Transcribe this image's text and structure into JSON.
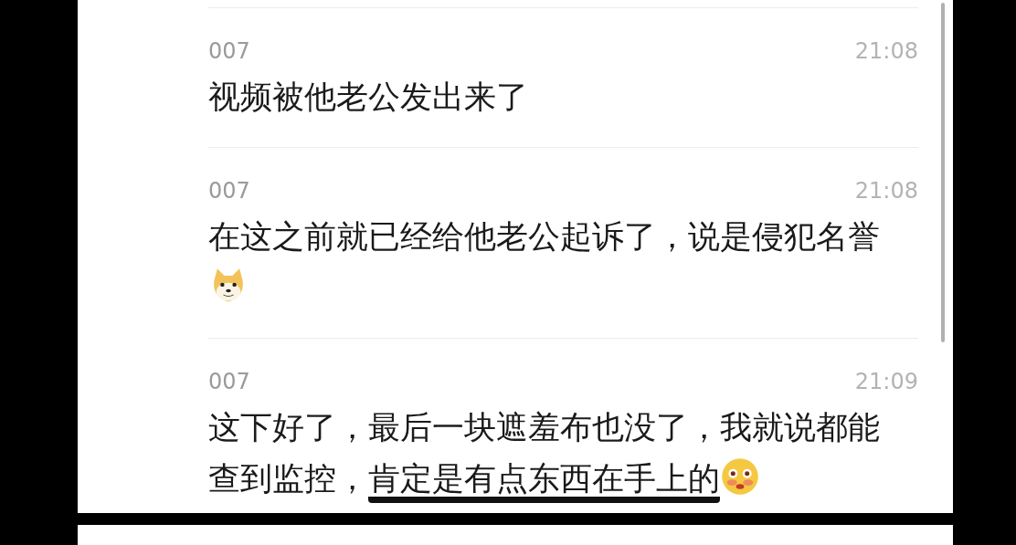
{
  "messages": [
    {
      "sender": "007",
      "time": "21:08",
      "lines": [
        {
          "parts": [
            {
              "text": "视频被他老公发出来了",
              "underlined": false
            }
          ]
        }
      ]
    },
    {
      "sender": "007",
      "time": "21:08",
      "lines": [
        {
          "parts": [
            {
              "text": "在这之前就已经给他老公起诉了，说是侵犯名誉",
              "underlined": false
            }
          ]
        }
      ],
      "emoji": {
        "kind": "dog"
      }
    },
    {
      "sender": "007",
      "time": "21:09",
      "lines": [
        {
          "parts": [
            {
              "text": "这下好了，最后一块遮羞布也没了，我就说都能",
              "underlined": false
            }
          ]
        },
        {
          "parts": [
            {
              "text": "查到监控，",
              "underlined": false
            },
            {
              "text": "肯定是有点东西在手上的",
              "underlined": true
            }
          ]
        }
      ],
      "emoji": {
        "kind": "flushed"
      }
    }
  ]
}
